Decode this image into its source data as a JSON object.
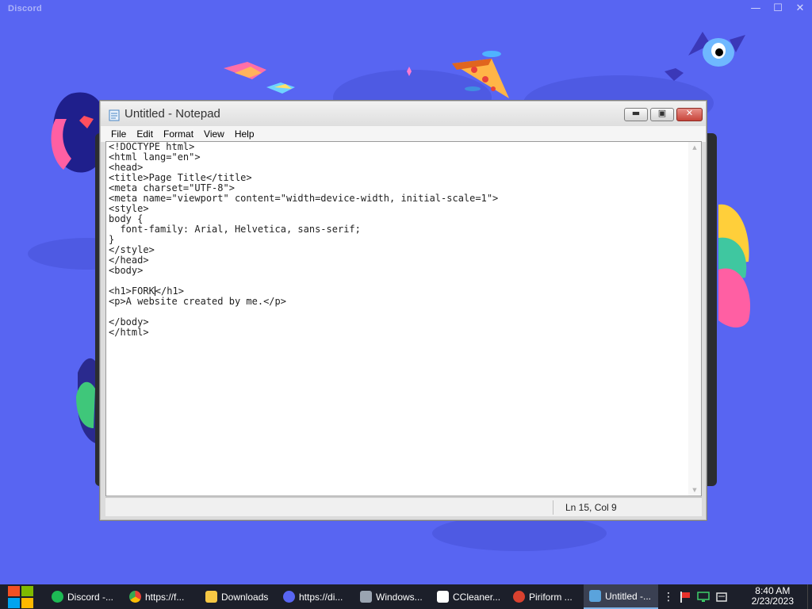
{
  "discord": {
    "title": "Discord",
    "window_controls": [
      "minimize-icon",
      "maximize-icon",
      "close-icon"
    ]
  },
  "notepad": {
    "title": "Untitled - Notepad",
    "menu": [
      "File",
      "Edit",
      "Format",
      "View",
      "Help"
    ],
    "content_before_caret": "<!DOCTYPE html>\n<html lang=\"en\">\n<head>\n<title>Page Title</title>\n<meta charset=\"UTF-8\">\n<meta name=\"viewport\" content=\"width=device-width, initial-scale=1\">\n<style>\nbody {\n  font-family: Arial, Helvetica, sans-serif;\n}\n</style>\n</head>\n<body>\n\n<h1>FORK",
    "content_after_caret": "</h1>\n<p>A website created by me.</p>\n\n</body>\n</html>",
    "status": "Ln 15, Col 9"
  },
  "taskbar": {
    "items": [
      {
        "label": "Discord -...",
        "icon": "spotify-icon",
        "color": "#1db954"
      },
      {
        "label": "https://f...",
        "icon": "chrome-icon",
        "color": "#e94235"
      },
      {
        "label": "Downloads",
        "icon": "folder-icon",
        "color": "#f6c744"
      },
      {
        "label": "https://di...",
        "icon": "discord-icon",
        "color": "#5865f2"
      },
      {
        "label": "Windows...",
        "icon": "monitor-icon",
        "color": "#9aa4b1"
      },
      {
        "label": "CCleaner...",
        "icon": "document-icon",
        "color": "#ffffff"
      },
      {
        "label": "Piriform ...",
        "icon": "ccleaner-icon",
        "color": "#d9412f"
      },
      {
        "label": "Untitled -...",
        "icon": "notepad-icon",
        "color": "#5aa3dc",
        "active": true
      }
    ],
    "tray_icons": [
      "overflow-icon",
      "flag-icon",
      "network-icon",
      "action-center-icon"
    ],
    "clock": {
      "time": "8:40 AM",
      "date": "2/23/2023"
    }
  }
}
